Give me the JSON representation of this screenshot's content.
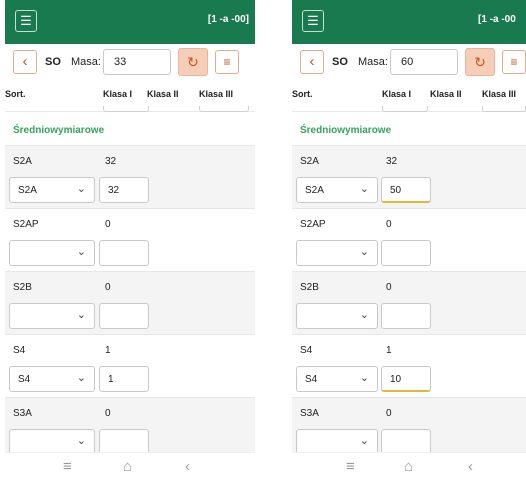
{
  "screens": [
    {
      "topbar": {
        "menu_icon": "☰",
        "status": "[1 -a -00]"
      },
      "toolbar": {
        "back_icon": "‹",
        "species": "SO",
        "masa_label": "Masa:",
        "masa_value": "33",
        "refresh_icon": "↻",
        "settings_icon": "≡"
      },
      "columns": {
        "sort": "Sort.",
        "k1": "Klasa I",
        "k2": "Klasa II",
        "k3": "Klasa III"
      },
      "section_title": "Średniowymiarowe",
      "rows": [
        {
          "name": "S2A",
          "value": "32",
          "select": "S2A",
          "input": "32"
        },
        {
          "name": "S2AP",
          "value": "0",
          "select": "",
          "input": ""
        },
        {
          "name": "S2B",
          "value": "0",
          "select": "",
          "input": ""
        },
        {
          "name": "S4",
          "value": "1",
          "select": "S4",
          "input": "1"
        },
        {
          "name": "S3A",
          "value": "0",
          "select": "",
          "input": ""
        }
      ],
      "nav": {
        "recents": "≡",
        "home": "⌂",
        "back": "‹"
      }
    },
    {
      "topbar": {
        "menu_icon": "☰",
        "status": "[1 -a -00"
      },
      "toolbar": {
        "back_icon": "‹",
        "species": "SO",
        "masa_label": "Masa:",
        "masa_value": "60",
        "refresh_icon": "↻",
        "settings_icon": "≡"
      },
      "columns": {
        "sort": "Sort.",
        "k1": "Klasa I",
        "k2": "Klasa II",
        "k3": "Klasa III"
      },
      "section_title": "Średniowymiarowe",
      "rows": [
        {
          "name": "S2A",
          "value": "32",
          "select": "S2A",
          "input": "50"
        },
        {
          "name": "S2AP",
          "value": "0",
          "select": "",
          "input": ""
        },
        {
          "name": "S2B",
          "value": "0",
          "select": "",
          "input": ""
        },
        {
          "name": "S4",
          "value": "1",
          "select": "S4",
          "input": "10"
        },
        {
          "name": "S3A",
          "value": "0",
          "select": "",
          "input": ""
        }
      ],
      "nav": {
        "recents": "≡",
        "home": "⌂",
        "back": "‹"
      }
    }
  ]
}
